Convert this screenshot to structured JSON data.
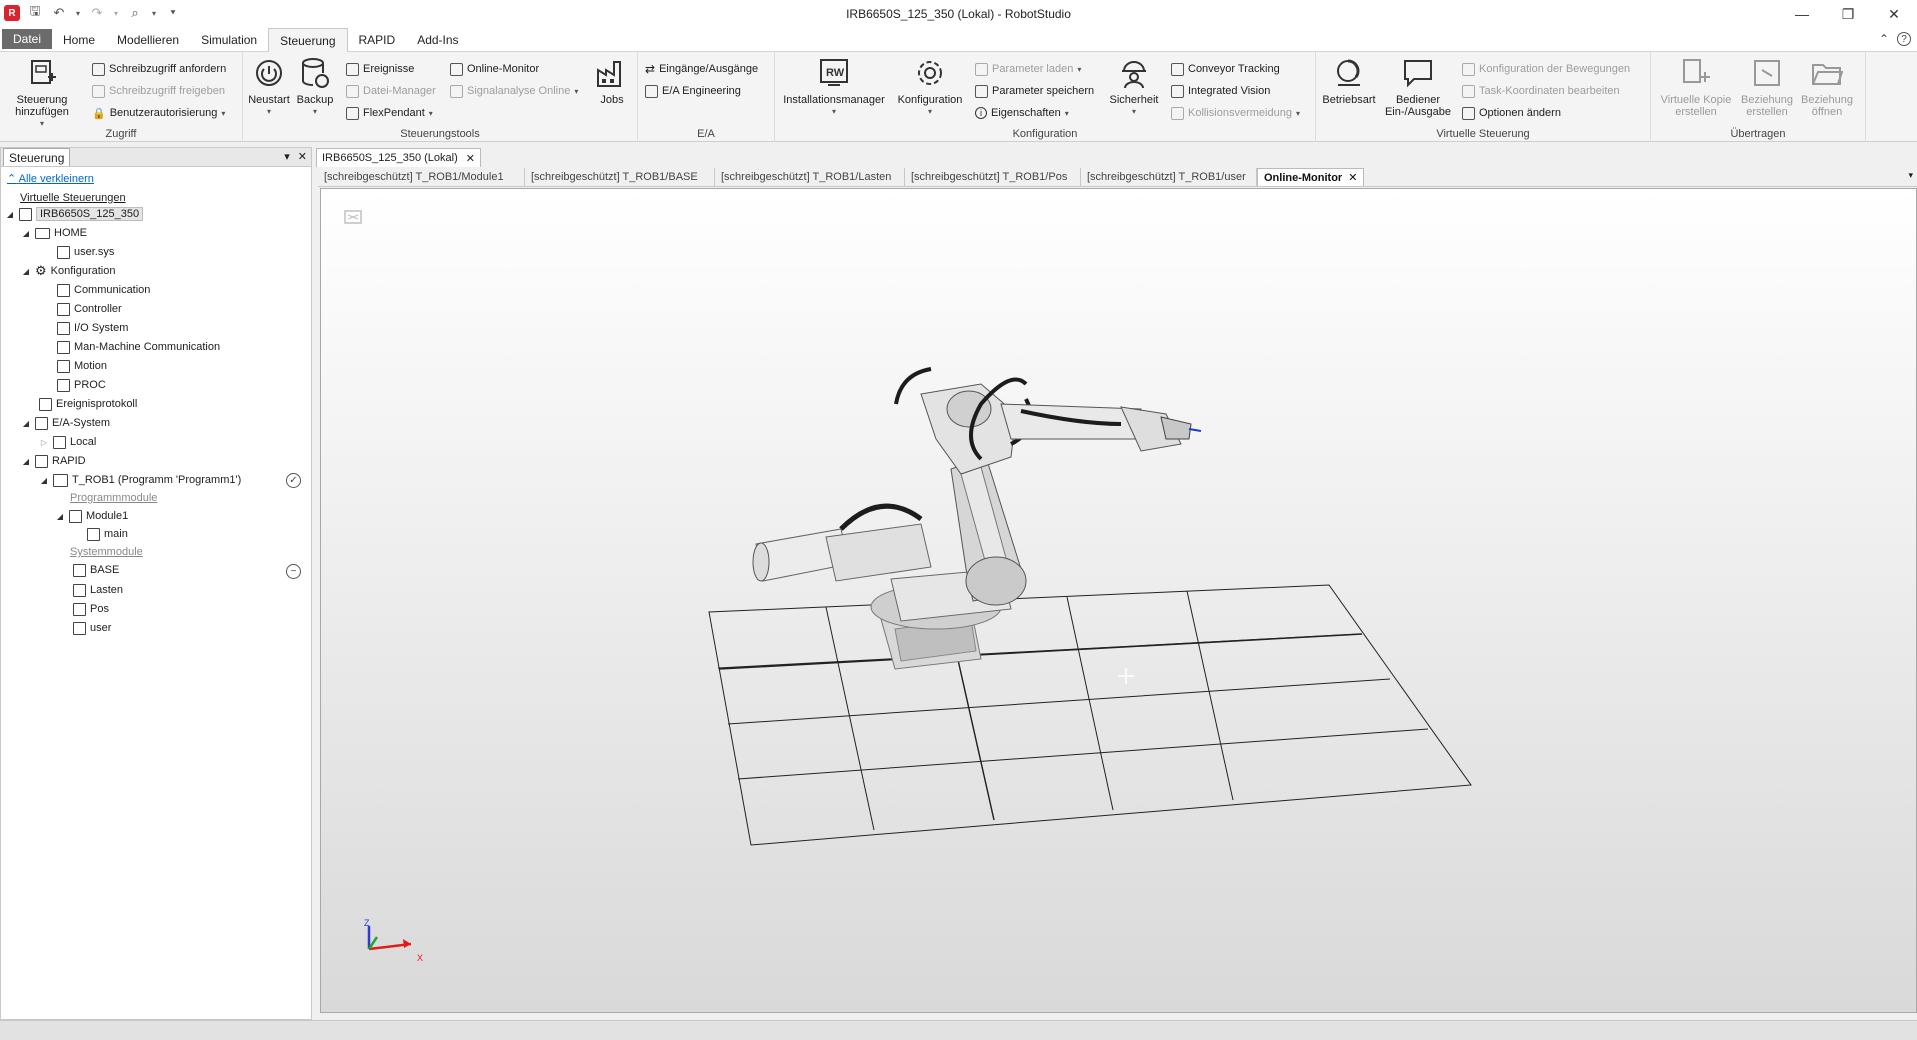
{
  "window": {
    "title": "IRB6650S_125_350 (Lokal) - RobotStudio",
    "controls": [
      "—",
      "❐",
      "✕"
    ]
  },
  "ribbon_tabs": [
    {
      "label": "Datei"
    },
    {
      "label": "Home"
    },
    {
      "label": "Modellieren"
    },
    {
      "label": "Simulation"
    },
    {
      "label": "Steuerung"
    },
    {
      "label": "RAPID"
    },
    {
      "label": "Add-Ins"
    }
  ],
  "ribbon": {
    "zugriff": {
      "label": "Zugriff",
      "add_controller": "Steuerung hinzufügen",
      "request_write": "Schreibzugriff anfordern",
      "release_write": "Schreibzugriff freigeben",
      "user_auth": "Benutzerautorisierung"
    },
    "tools": {
      "label": "Steuerungstools",
      "restart": "Neustart",
      "backup": "Backup",
      "events": "Ereignisse",
      "file_manager": "Datei-Manager",
      "flexpendant": "FlexPendant",
      "online_monitor": "Online-Monitor",
      "signal_analysis": "Signalanalyse Online",
      "jobs": "Jobs"
    },
    "io": {
      "label": "E/A",
      "inputs_outputs": "Eingänge/Ausgänge",
      "io_engineering": "E/A Engineering"
    },
    "config": {
      "label": "Konfiguration",
      "installation_manager": "Installationsmanager",
      "configuration": "Konfiguration",
      "load_params": "Parameter laden",
      "save_params": "Parameter speichern",
      "properties": "Eigenschaften",
      "safety": "Sicherheit",
      "conveyor": "Conveyor Tracking",
      "vision": "Integrated Vision",
      "collision": "Kollisionsvermeidung"
    },
    "virtual": {
      "label": "Virtuelle Steuerung",
      "operating_mode": "Betriebsart",
      "operator_io": "Bediener Ein-/Ausgabe",
      "motion_config": "Konfiguration der Bewegungen",
      "task_frames": "Task-Koordinaten bearbeiten",
      "change_options": "Optionen ändern"
    },
    "transfer": {
      "label": "Übertragen",
      "virtual_copy": "Virtuelle Kopie erstellen",
      "create_relation": "Beziehung erstellen",
      "open_relation": "Beziehung öffnen"
    }
  },
  "left_panel": {
    "title": "Steuerung",
    "collapse_all": "Alle verkleinern",
    "tree": {
      "root": "Virtuelle Steuerungen",
      "controller": "IRB6650S_125_350",
      "home": "HOME",
      "usersys": "user.sys",
      "configuration": "Konfiguration",
      "cfg_items": [
        "Communication",
        "Controller",
        "I/O System",
        "Man-Machine Communication",
        "Motion",
        "PROC"
      ],
      "event_log": "Ereignisprotokoll",
      "io_system": "E/A-System",
      "local": "Local",
      "rapid": "RAPID",
      "task": "T_ROB1 (Programm 'Programm1')",
      "program_modules": "Programmmodule",
      "module1": "Module1",
      "main": "main",
      "system_modules": "Systemmodule",
      "sys_items": [
        "BASE",
        "Lasten",
        "Pos",
        "user"
      ]
    }
  },
  "doc_tab": "IRB6650S_125_350 (Lokal)",
  "editor_tabs": [
    "[schreibgeschützt] T_ROB1/Module1",
    "[schreibgeschützt] T_ROB1/BASE",
    "[schreibgeschützt] T_ROB1/Lasten",
    "[schreibgeschützt] T_ROB1/Pos",
    "[schreibgeschützt] T_ROB1/user",
    "Online-Monitor"
  ],
  "viewport": {
    "axis_x": "X",
    "axis_z": "Z"
  }
}
